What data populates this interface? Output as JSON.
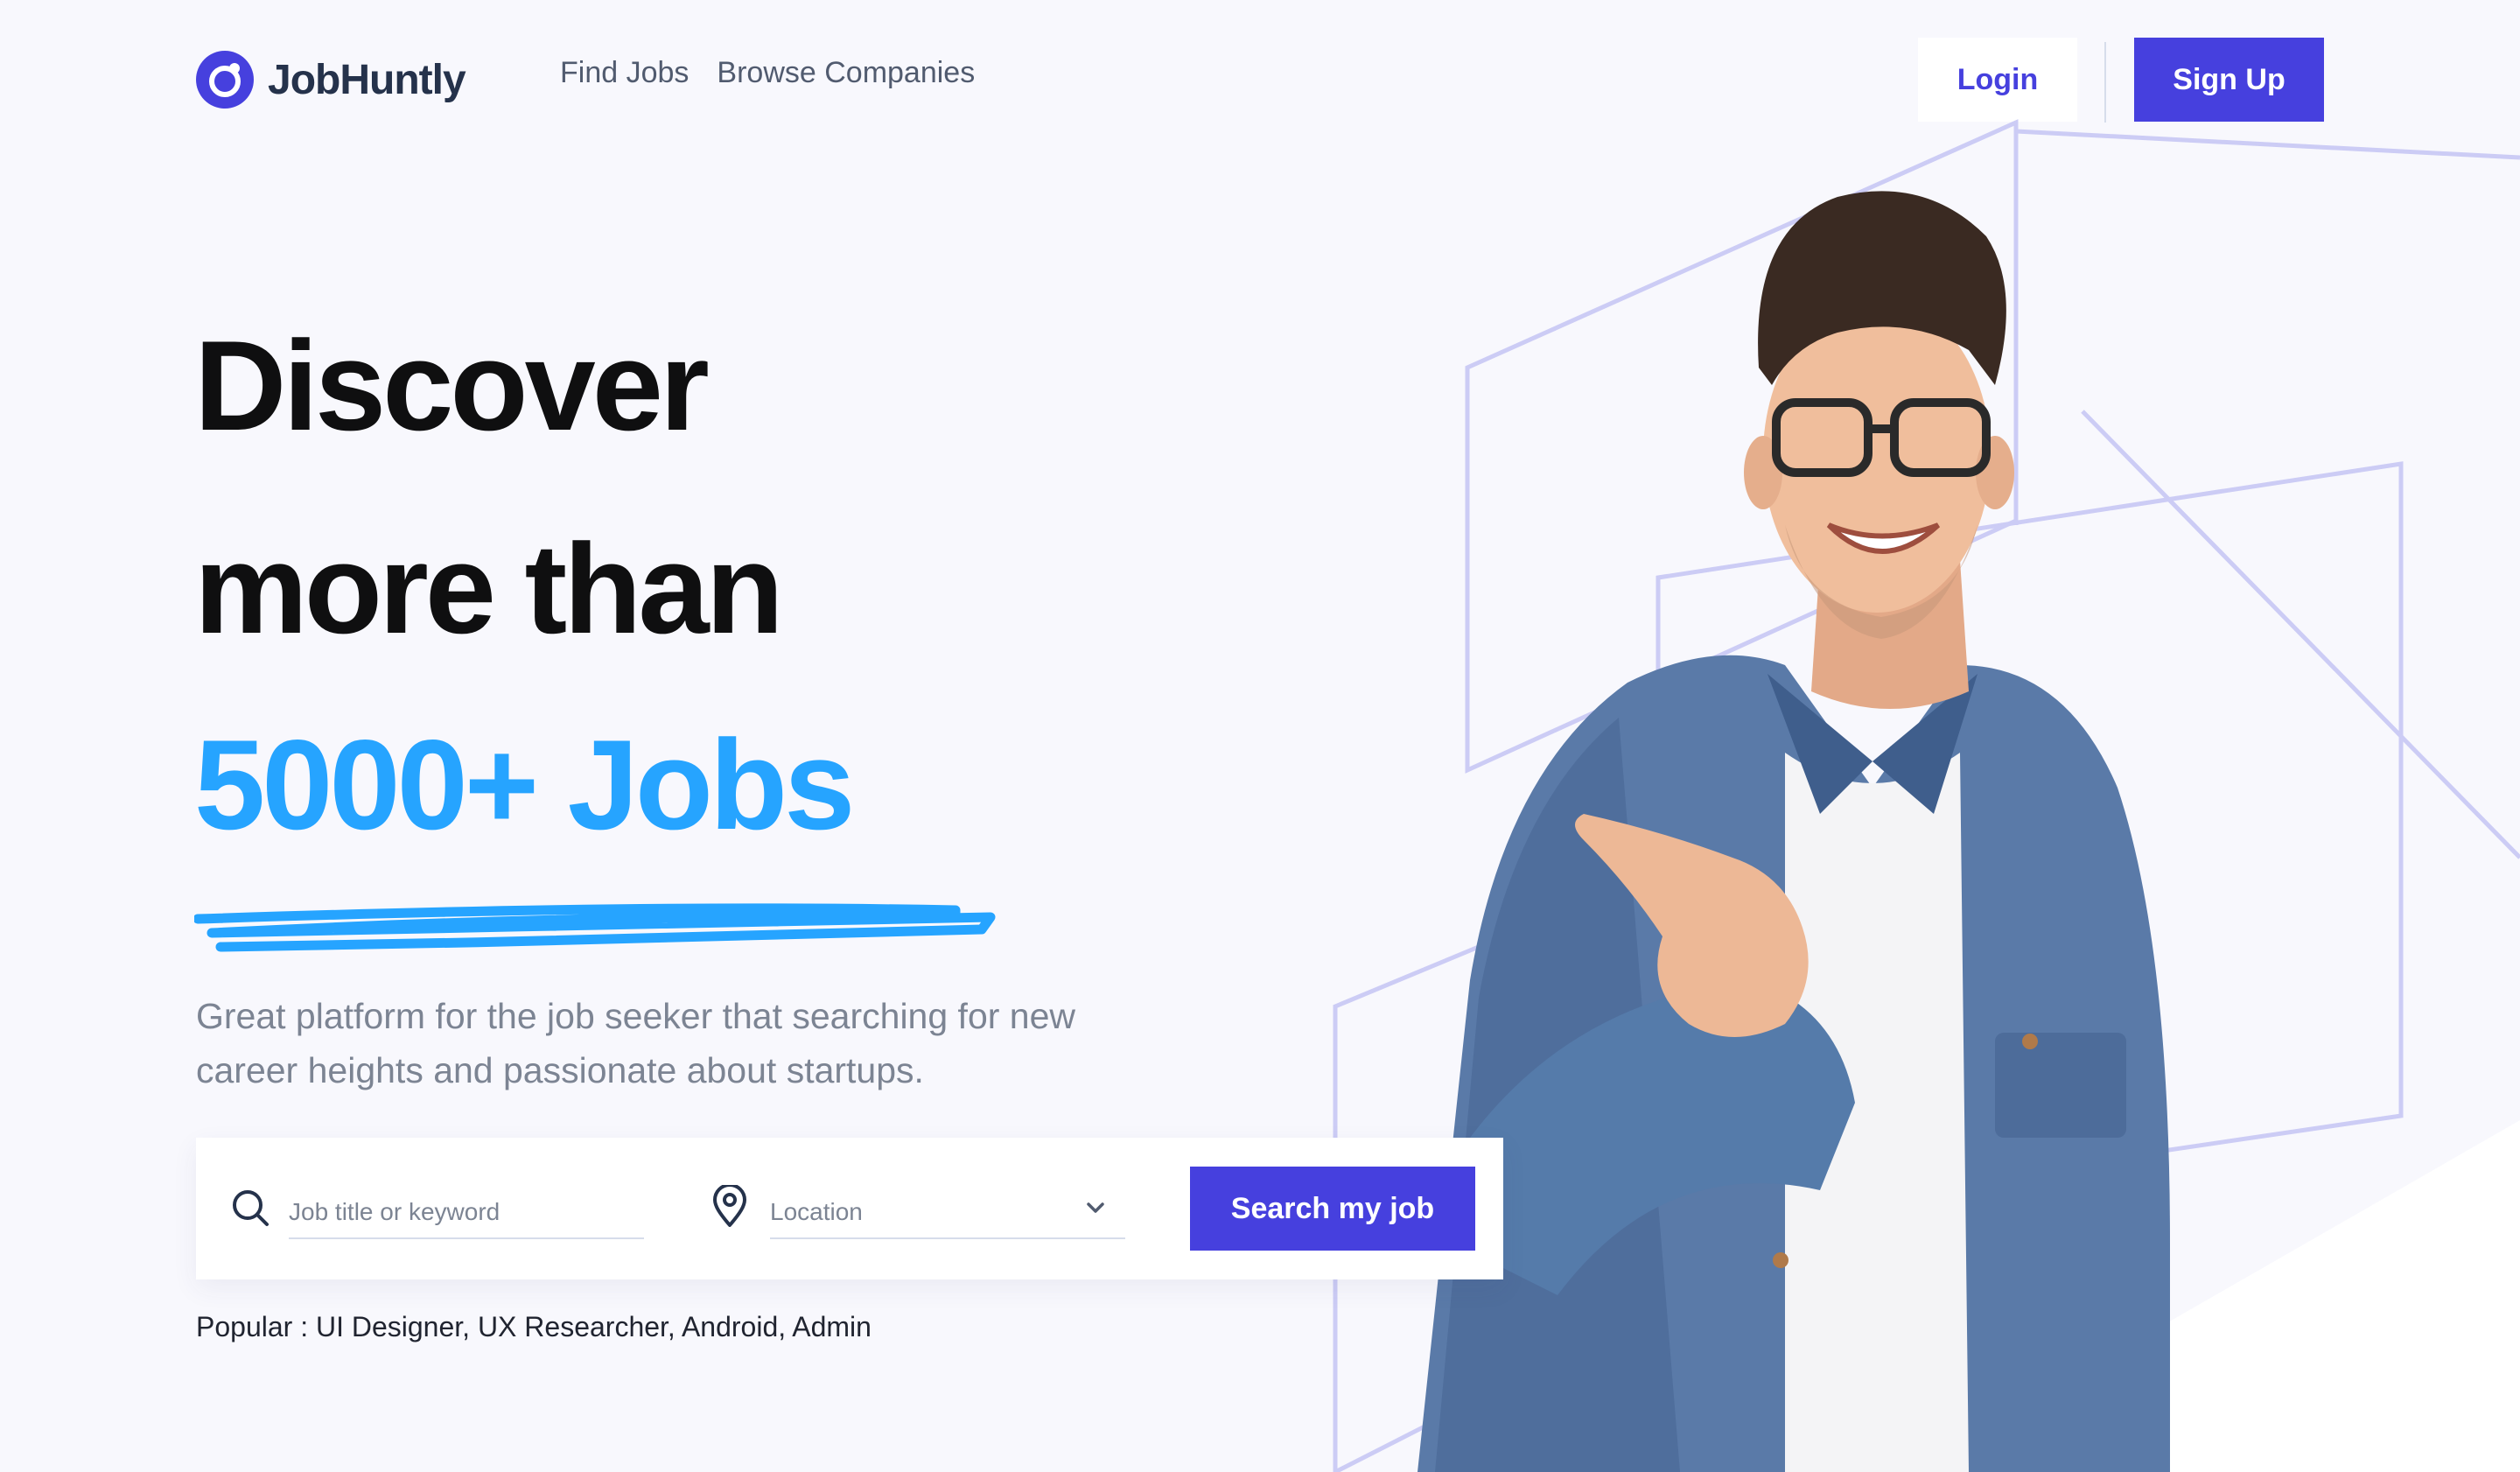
{
  "brand": {
    "name": "JobHuntly",
    "accent": "#4640DE",
    "highlight": "#26A4FF"
  },
  "nav": {
    "links": [
      "Find Jobs",
      "Browse Companies"
    ]
  },
  "auth": {
    "login_label": "Login",
    "signup_label": "Sign Up"
  },
  "hero": {
    "line1": "Discover",
    "line2": "more than",
    "line3": "5000+ Jobs",
    "subtitle": "Great platform for the job seeker that searching for new career heights and passionate about startups."
  },
  "search": {
    "keyword_placeholder": "Job title or keyword",
    "location_placeholder": "Location",
    "button_label": "Search my job",
    "icons": {
      "keyword": "search-icon",
      "location": "location-pin-icon",
      "dropdown": "chevron-down-icon"
    }
  },
  "popular": {
    "prefix": "Popular : ",
    "items": [
      "UI Designer",
      "UX Researcher",
      "Android",
      "Admin"
    ]
  }
}
